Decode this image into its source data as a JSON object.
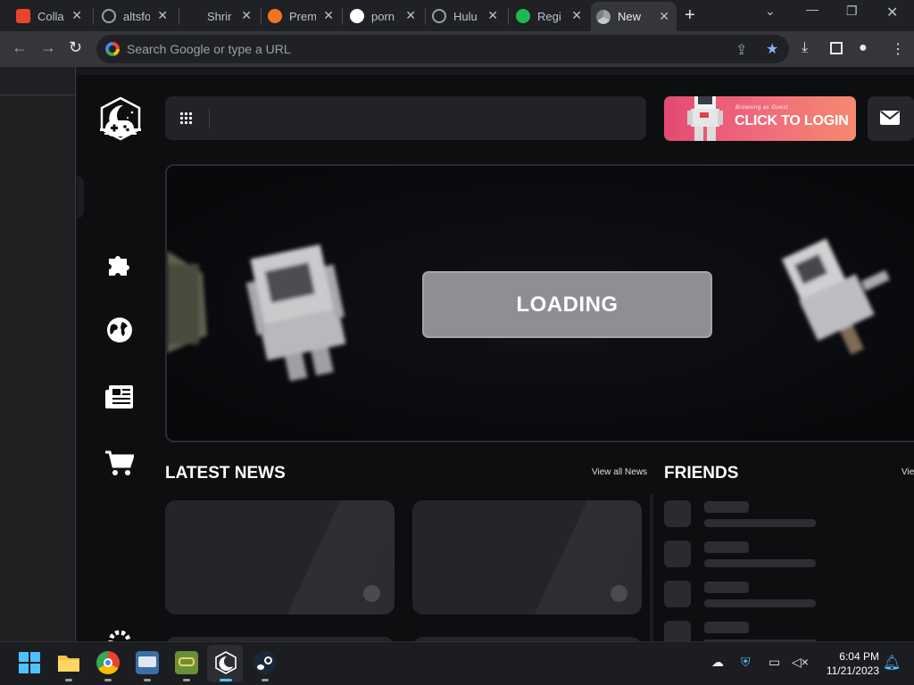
{
  "browser": {
    "tabs": [
      {
        "title": "Colla",
        "favicon_color": "#e8452c"
      },
      {
        "title": "altsfo",
        "favicon_color": "#9aa0a6"
      },
      {
        "title": "Shrir",
        "favicon_color": "#202124"
      },
      {
        "title": "Prem",
        "favicon_color": "#f47521"
      },
      {
        "title": "porn",
        "favicon_color": "#ffffff"
      },
      {
        "title": "Hulu",
        "favicon_color": "#9aa0a6"
      },
      {
        "title": "Regi",
        "favicon_color": "#1db954"
      },
      {
        "title": "New",
        "favicon_color": "#9aa0a6",
        "active": true
      }
    ],
    "omnibox_placeholder": "Search Google or type a URL"
  },
  "app": {
    "hero": {
      "loading_label": "LOADING"
    },
    "login": {
      "subtitle": "Browsing as Guest",
      "label": "CLICK TO LOGIN"
    },
    "news": {
      "title": "LATEST NEWS",
      "view_all": "View all News"
    },
    "friends": {
      "title": "FRIENDS",
      "view_all": "Vie"
    },
    "colors": {
      "accent_login": "#f06a7c",
      "background": "#0d0e10"
    }
  },
  "taskbar": {
    "time": "6:04 PM",
    "date": "11/21/2023"
  }
}
